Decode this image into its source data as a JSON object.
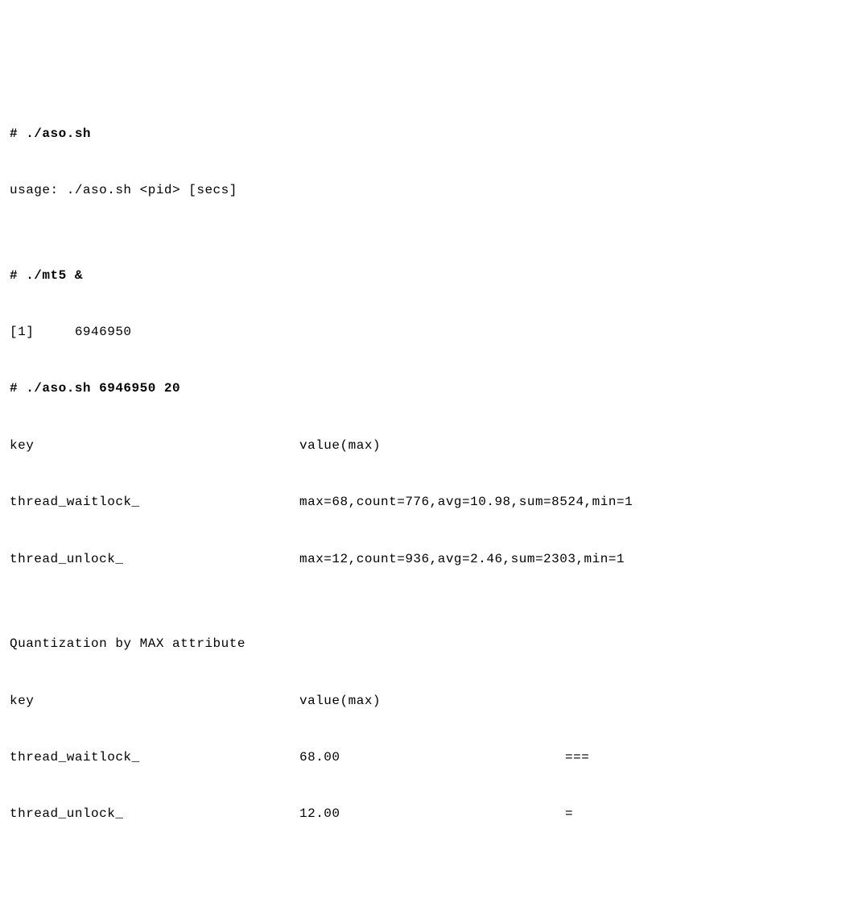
{
  "cmd1": "# ./aso.sh",
  "usage": "usage: ./aso.sh <pid> [secs]",
  "blank": "",
  "cmd2": "# ./mt5 &",
  "jobline": "[1]     6946950",
  "cmd3": "# ./aso.sh 6946950 20",
  "hdr_key": "key",
  "hdr_val": "value(max)",
  "rows1": [
    {
      "key": "thread_waitlock_",
      "val": "max=68,count=776,avg=10.98,sum=8524,min=1"
    },
    {
      "key": "thread_unlock_",
      "val": "max=12,count=936,avg=2.46,sum=2303,min=1"
    }
  ],
  "section2_title": "Quantization by MAX attribute",
  "rows2": [
    {
      "key": "thread_waitlock_",
      "val": "68.00",
      "bar": "==="
    },
    {
      "key": "thread_unlock_",
      "val": "12.00",
      "bar": "="
    }
  ]
}
